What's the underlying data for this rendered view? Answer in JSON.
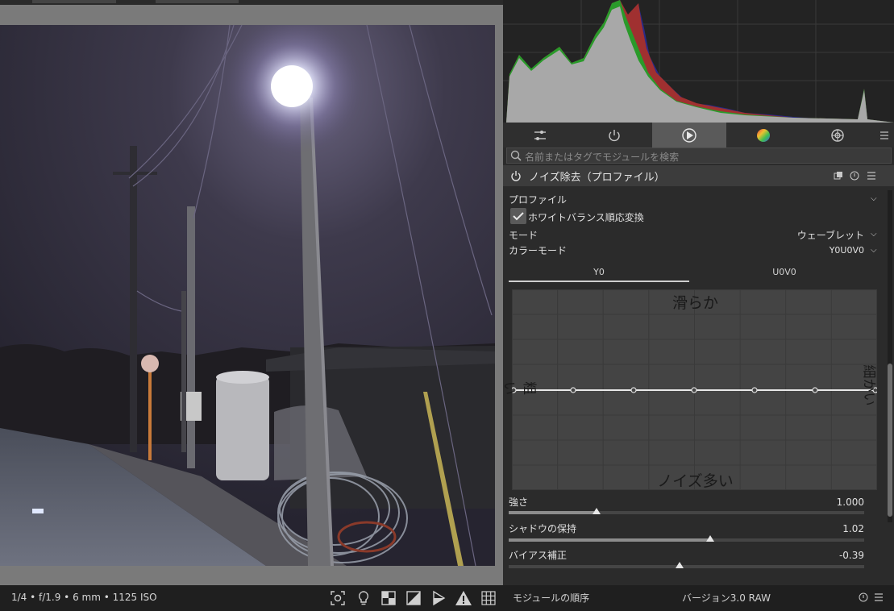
{
  "image_info": "1/4 • f/1.9 • 6 mm • 1125 ISO",
  "toolbar_icons": [
    "focus-peaking-icon",
    "bulb-icon",
    "color-assessment-icon",
    "softproof-icon",
    "gamut-check-icon",
    "overexposed-warning-icon",
    "guides-grid-icon"
  ],
  "module_tabs": [
    {
      "name": "quick-access-tab",
      "icon": "sliders-icon"
    },
    {
      "name": "active-modules-tab",
      "icon": "power-icon"
    },
    {
      "name": "correct-modules-tab",
      "icon": "correct-icon",
      "active": true
    },
    {
      "name": "color-modules-tab",
      "icon": "color-ball-icon"
    },
    {
      "name": "effects-modules-tab",
      "icon": "effects-icon"
    }
  ],
  "search": {
    "placeholder": "名前またはタグでモジュールを検索"
  },
  "module": {
    "title": "ノイズ除去（プロファイル）",
    "profile_label": "プロファイル",
    "wb_checkbox_label": "ホワイトバランス順応変換",
    "wb_checked": true,
    "mode_label": "モード",
    "mode_value": "ウェーブレット",
    "color_mode_label": "カラーモード",
    "color_mode_value": "Y0U0V0",
    "tabs": [
      "Y0",
      "U0V0"
    ],
    "active_tab": "Y0",
    "curve": {
      "top_label": "滑らか",
      "bottom_label": "ノイズ多い",
      "left_label": "粗い",
      "right_label": "細かい",
      "node_count": 8
    },
    "sliders": [
      {
        "label": "強さ",
        "value": "1.000",
        "level": 0.24
      },
      {
        "label": "シャドウの保持",
        "value": "1.02",
        "level": 0.57
      },
      {
        "label": "バイアス補正",
        "value": "-0.39",
        "level": 0.48
      }
    ]
  },
  "bottom_bar": {
    "module_order_label": "モジュールの順序",
    "version_label": "バージョン3.0 RAW"
  },
  "colors": {
    "panel_bg": "#2b2b2b",
    "active_tab": "#5a5a5a",
    "accent_text": "#e6e6e6"
  }
}
